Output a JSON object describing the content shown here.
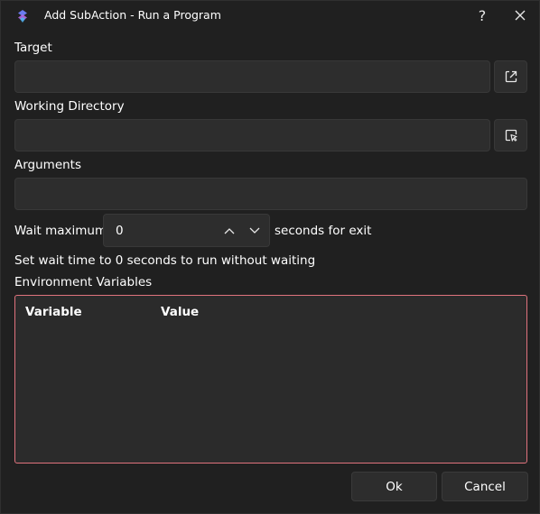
{
  "window": {
    "title": "Add SubAction - Run a Program",
    "help_glyph": "?",
    "app_icon": "streamerbot-logo-icon"
  },
  "form": {
    "target_label": "Target",
    "target_value": "",
    "working_dir_label": "Working Directory",
    "working_dir_value": "",
    "arguments_label": "Arguments",
    "arguments_value": "",
    "wait_prefix": "Wait maximum",
    "wait_value": "0",
    "wait_suffix": "seconds for exit",
    "hint": "Set wait time to 0 seconds to run without waiting",
    "env_label": "Environment Variables",
    "env_columns": [
      "Variable",
      "Value"
    ],
    "env_rows": []
  },
  "footer": {
    "ok_label": "Ok",
    "cancel_label": "Cancel"
  },
  "colors": {
    "background": "#202020",
    "field": "#2d2d2d",
    "env_border_error": "#e0737d"
  }
}
